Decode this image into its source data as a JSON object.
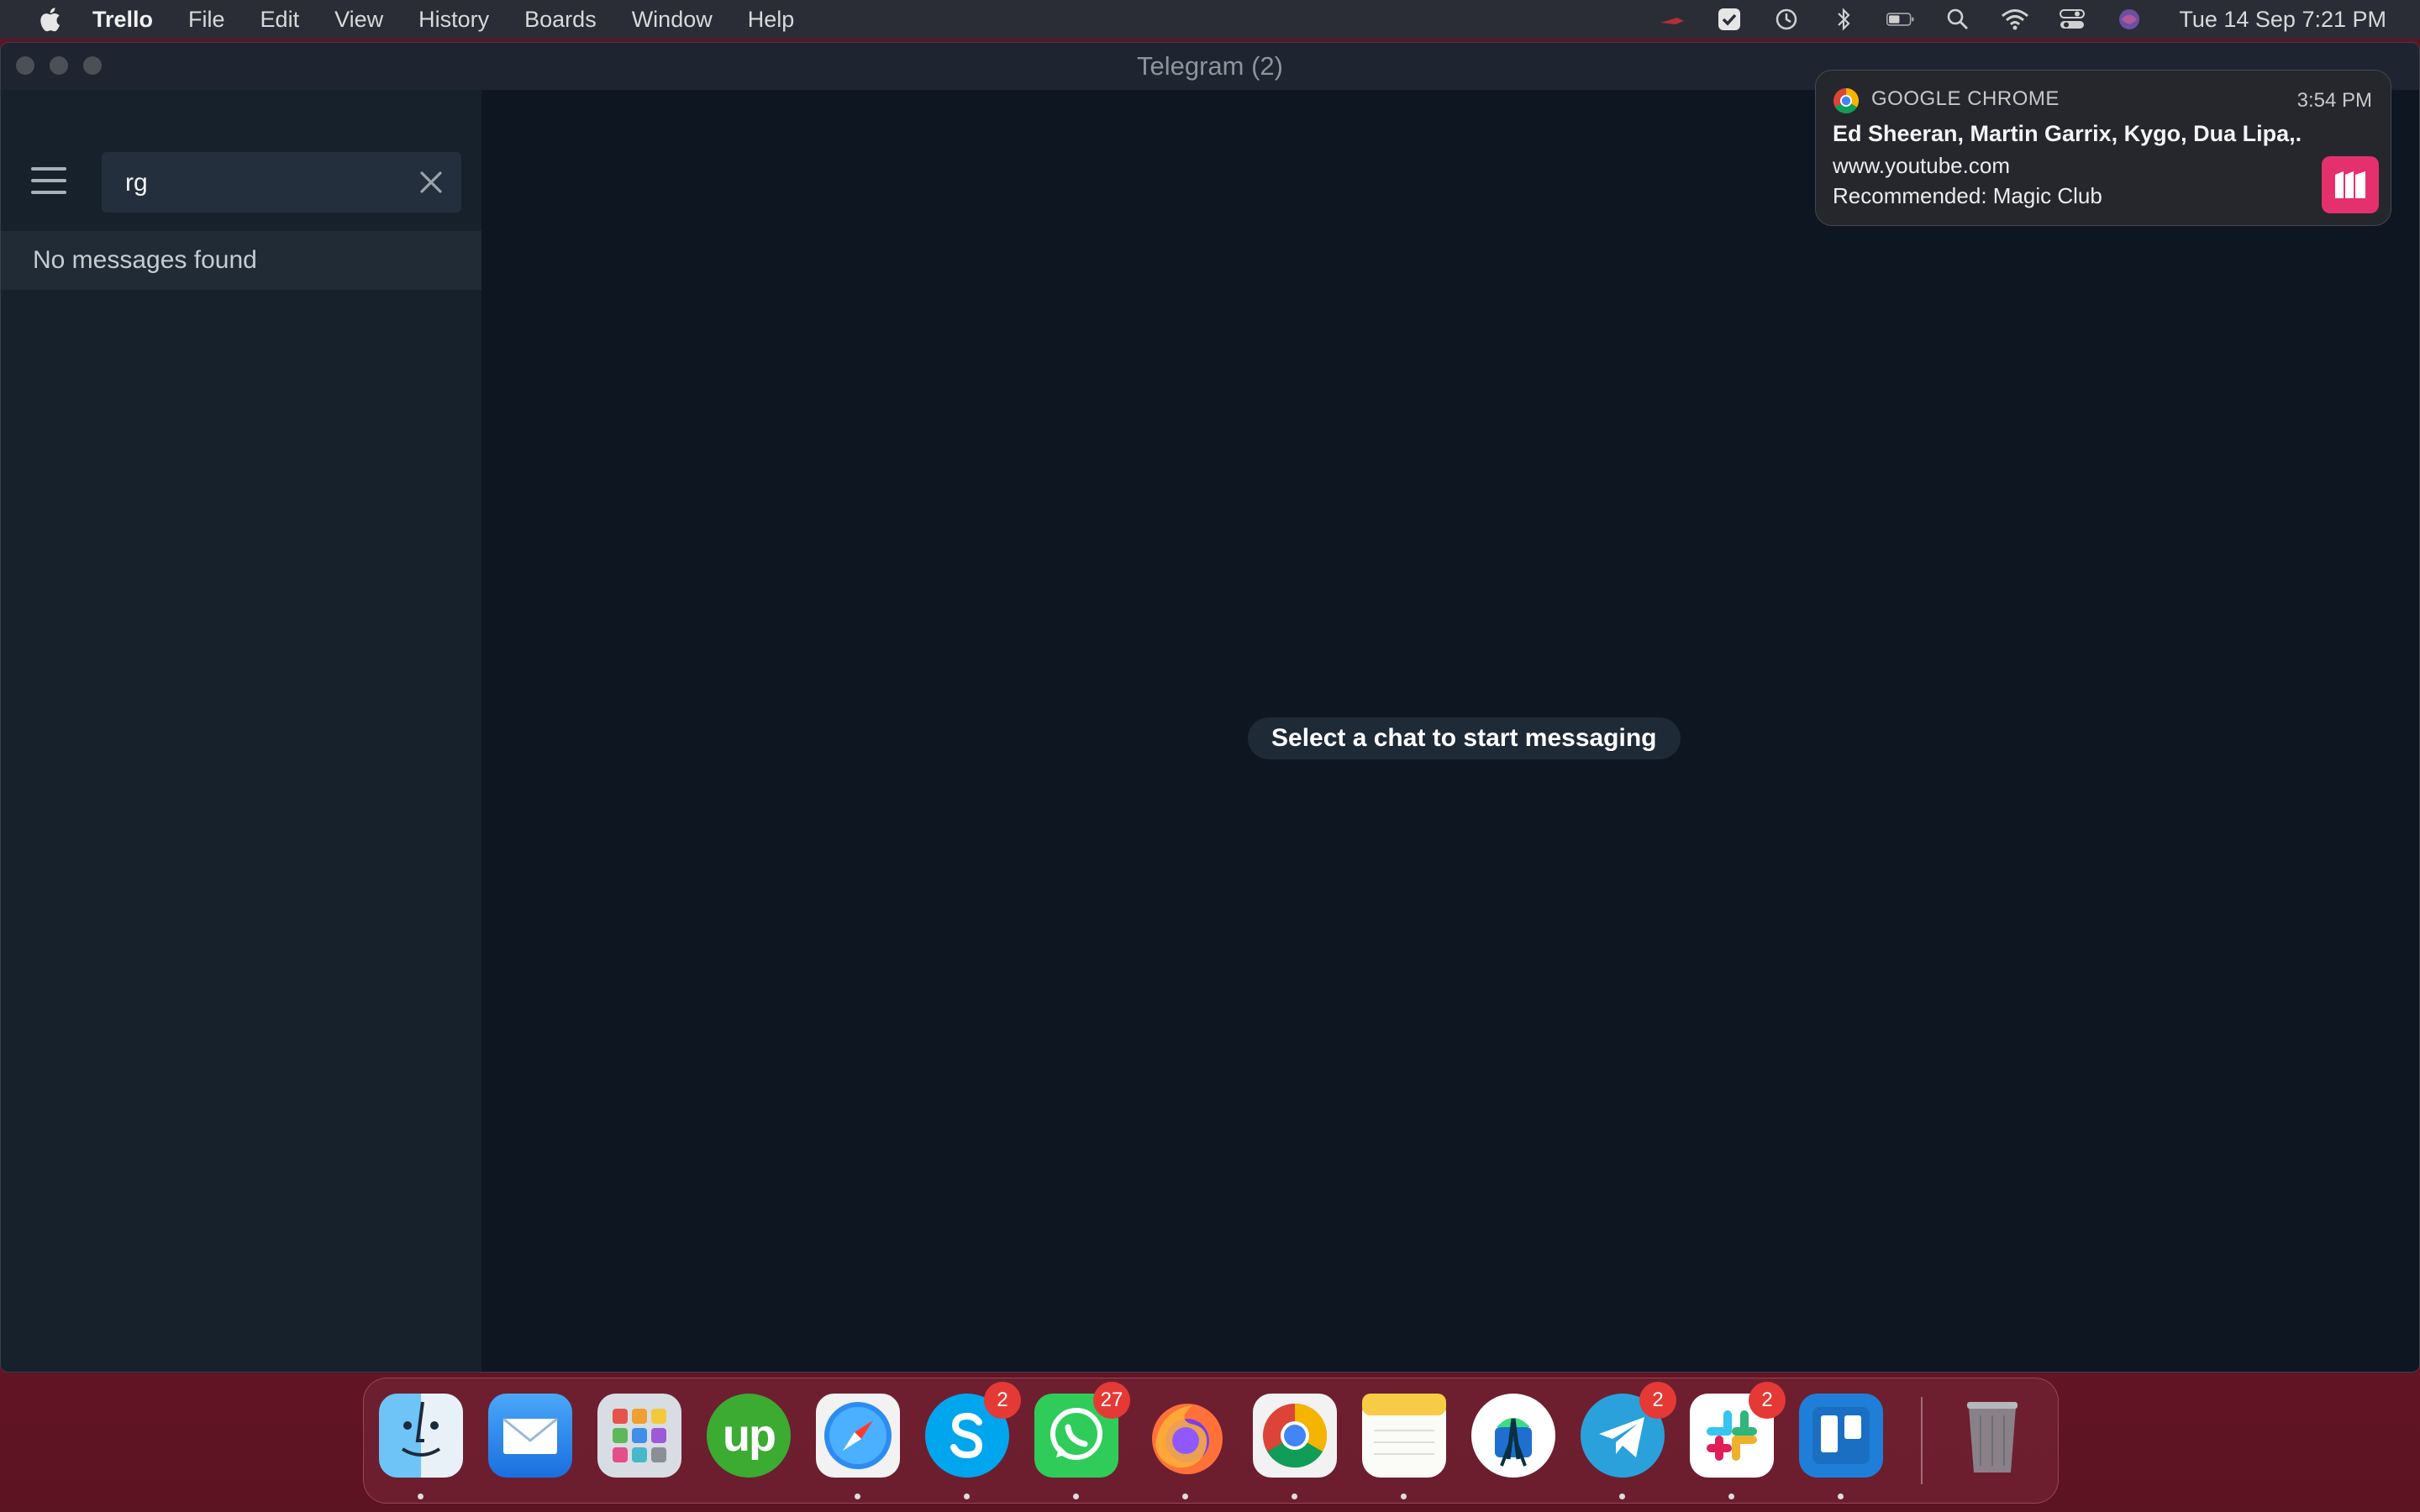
{
  "menubar": {
    "app_name": "Trello",
    "items": [
      "File",
      "Edit",
      "View",
      "History",
      "Boards",
      "Window",
      "Help"
    ],
    "clock": "Tue 14 Sep  7:21 PM",
    "status_icons": [
      "spotlight-dot-icon",
      "checkmark-app-icon",
      "time-machine-icon",
      "bluetooth-icon",
      "battery-icon",
      "search-icon",
      "wifi-icon",
      "control-center-icon",
      "siri-icon"
    ]
  },
  "window": {
    "title": "Telegram (2)",
    "search": {
      "value": "rg"
    },
    "no_results": "No messages found",
    "empty_state": "Select a chat to start messaging"
  },
  "notification": {
    "app": "GOOGLE CHROME",
    "time": "3:54 PM",
    "title": "Ed Sheeran, Martin Garrix, Kygo, Dua Lipa,...",
    "subtitle": "www.youtube.com",
    "body": "Recommended: Magic Club"
  },
  "dock": {
    "items": [
      {
        "name": "finder",
        "badge": null
      },
      {
        "name": "mail",
        "badge": null
      },
      {
        "name": "launchpad",
        "badge": null
      },
      {
        "name": "upwork",
        "badge": null
      },
      {
        "name": "safari",
        "badge": null
      },
      {
        "name": "skype",
        "badge": "2"
      },
      {
        "name": "whatsapp",
        "badge": "27"
      },
      {
        "name": "firefox",
        "badge": null
      },
      {
        "name": "chrome",
        "badge": null
      },
      {
        "name": "notes",
        "badge": null
      },
      {
        "name": "android-studio",
        "badge": null
      },
      {
        "name": "telegram",
        "badge": "2"
      },
      {
        "name": "slack",
        "badge": "2"
      },
      {
        "name": "trello",
        "badge": null
      },
      {
        "name": "trash",
        "badge": null
      }
    ],
    "upwork_label": "up"
  },
  "colors": {
    "window_bg": "#0e1621",
    "sidebar_bg": "#17212b",
    "accent": "#2aa1da",
    "badge": "#e53935"
  }
}
